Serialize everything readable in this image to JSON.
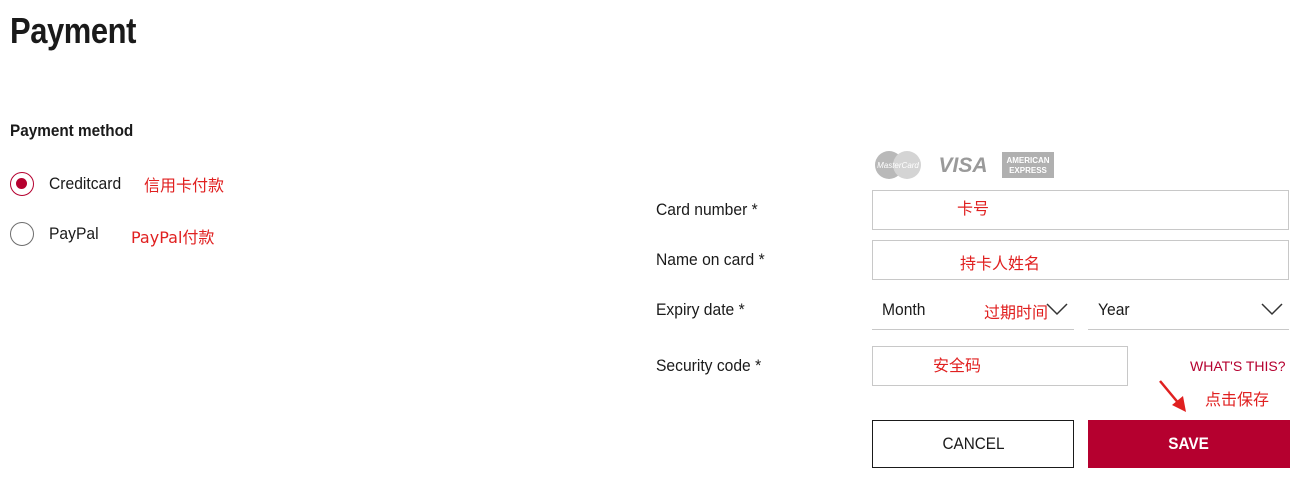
{
  "page": {
    "title": "Payment"
  },
  "payment_method": {
    "label": "Payment method",
    "options": [
      {
        "label": "Creditcard",
        "selected": true,
        "annotation": "信用卡付款"
      },
      {
        "label": "PayPal",
        "selected": false,
        "annotation": "PayPal付款"
      }
    ]
  },
  "card_logos": [
    "mastercard-logo",
    "visa-logo",
    "american-express-logo"
  ],
  "form": {
    "card_number": {
      "label": "Card number *",
      "value": "",
      "annotation": "卡号"
    },
    "name_on_card": {
      "label": "Name on card *",
      "value": "",
      "annotation": "持卡人姓名"
    },
    "expiry_date": {
      "label": "Expiry date *",
      "month": "Month",
      "year": "Year",
      "annotation": "过期时间"
    },
    "security_code": {
      "label": "Security code *",
      "value": "",
      "annotation": "安全码"
    },
    "whats_this": "WHAT'S THIS?"
  },
  "actions": {
    "cancel": "CANCEL",
    "save": "SAVE",
    "save_annotation": "点击保存"
  },
  "colors": {
    "accent": "#b5002f",
    "annotation": "#e02020",
    "border": "#c8c8c8"
  }
}
